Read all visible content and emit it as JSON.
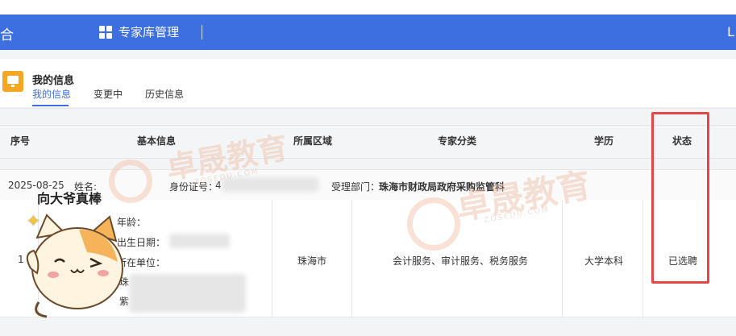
{
  "header": {
    "left_glyph": "合",
    "title": "专家库管理",
    "right_glyph": "L"
  },
  "panel": {
    "title": "我的信息",
    "tabs": [
      "我的信息",
      "变更中",
      "历史信息"
    ]
  },
  "table": {
    "headers": [
      "序号",
      "基本信息",
      "所属区域",
      "专家分类",
      "学历",
      "状态"
    ],
    "group": {
      "date": "2025-08-25",
      "name_label": "姓名:",
      "id_label": "身份证号：",
      "id_partial": "4",
      "dept_label": "受理部门：",
      "dept_value": "珠海市财政局政府采购监管科"
    },
    "row": {
      "index": "1",
      "detail_labels": [
        "年龄：",
        "出生日期：",
        "所在单位：",
        "珠",
        "紫"
      ],
      "region": "珠海市",
      "category": "会计服务、审计服务、税务服务",
      "education": "大学本科",
      "status": "已选聘"
    }
  },
  "watermark": {
    "brand": "卓晟教育",
    "site": "ZOSEDU.COM"
  },
  "sticker": {
    "caption": "向大爷真棒"
  },
  "colors": {
    "header_blue": "#3d6fe0",
    "highlight_red": "#e64545",
    "icon_orange": "#f5a623"
  }
}
